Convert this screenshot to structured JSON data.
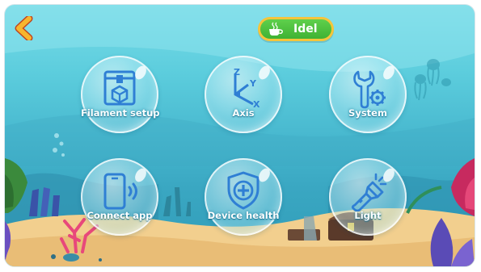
{
  "status": {
    "text": "Idel",
    "icon": "coffee-cup-icon"
  },
  "nav": {
    "back_icon": "chevron-left-icon"
  },
  "menu": [
    {
      "label": "Filament setup",
      "icon": "filament-box-icon"
    },
    {
      "label": "Axis",
      "icon": "xyz-axis-icon"
    },
    {
      "label": "System",
      "icon": "wrench-gear-icon"
    },
    {
      "label": "Connect app",
      "icon": "phone-signal-icon"
    },
    {
      "label": "Device health",
      "icon": "shield-plus-icon"
    },
    {
      "label": "Light",
      "icon": "flashlight-icon"
    }
  ],
  "colors": {
    "accent_yellow": "#f5c53b",
    "status_green": "#3fb233",
    "icon_blue": "#2f7fd4",
    "water": "#5ccddd",
    "sand": "#f2cf8e"
  }
}
